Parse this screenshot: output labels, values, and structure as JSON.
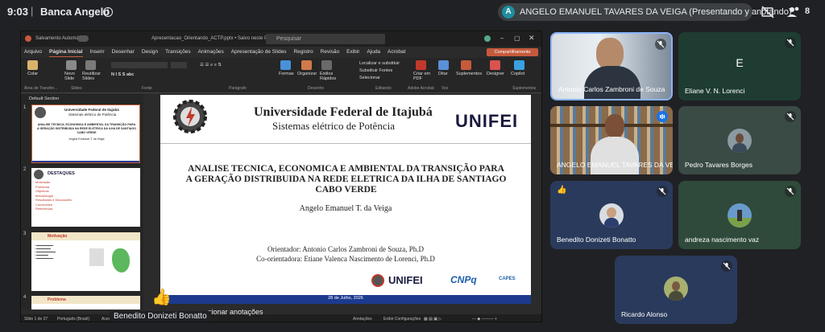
{
  "meet": {
    "time": "9:03",
    "separator": "|",
    "meeting_name": "Banca Angelo",
    "presenter_initial": "A",
    "presenter_text": "ANGELO EMANUEL TAVARES DA VEIGA (Presentando y anotando)",
    "people_count": "8",
    "caption_name": "Benedito Donizeti Bonatto",
    "notes_text": "cionar anotações"
  },
  "ppt": {
    "title_left": "Salvamento Automático",
    "title_file": "Apresentacao_Orientando_ACTP.pptx • Salvo neste PC",
    "search_placeholder": "Pesquisar",
    "menu": [
      "Arquivo",
      "Página Inicial",
      "Inserir",
      "Desenhar",
      "Design",
      "Transições",
      "Animações",
      "Apresentação de Slides",
      "Registro",
      "Revisão",
      "Exibir",
      "Ajuda",
      "Acrobat"
    ],
    "active_menu": "Página Inicial",
    "share_label": "Compartilhamento",
    "ribbon": {
      "colar": "Colar",
      "novo_slide": "Novo Slide",
      "reuse": "Reutilizar Slides",
      "formas": "Formas",
      "organizar": "Organizar",
      "estilos": "Estilos Rápidos",
      "localizar": "Localizar e substituir",
      "substituir": "Substituir Fontes",
      "selecionar": "Selecionar",
      "criar_pdf": "Criar em PDF",
      "ditar": "Ditar",
      "suplementos": "Suplementos",
      "designer": "Designer",
      "copilot": "Copilot",
      "groups": [
        "Área de Transfer...",
        "Slides",
        "Fonte",
        "Parágrafo",
        "Desenho",
        "Editando",
        "Adobe Acrobat",
        "Voz",
        "Suplementos"
      ]
    },
    "section_label": "Default Section",
    "thumb2_title": "DESTAQUES",
    "thumb2_items": [
      "Motivação",
      "Problema",
      "Objetivos",
      "Metodologia",
      "Resultados e Discussões",
      "Conclusões",
      "Referências"
    ],
    "thumb3_title": "Motivação",
    "thumb4_title": "Problema",
    "status_slide": "Slide 1 de 27",
    "status_lang": "Português (Brasil)",
    "status_acc": "Acessibilidade",
    "status_notes": "Anotações",
    "status_view": "Exibir Configurações"
  },
  "slide": {
    "university": "Universidade Federal de Itajubá",
    "subtitle": "Sistemas elétrico de Potência",
    "logo_text": "UNIFEI",
    "title_lines": [
      "ANALISE TECNICA,  ECONOMICA E AMBIENTAL DA TRANSIÇÃO PARA",
      "A GERAÇÃO DISTRIBUIDA NA REDE ELETRICA DA ILHA DE SANTIAGO",
      "CABO VERDE"
    ],
    "author": "Angelo Emanuel T. da Veiga",
    "advisor": "Orientador: Antonio Carlos Zambroni de Souza, Ph.D",
    "coadvisor": "Co-orientadora: Etiane Valenca Nascimento de Lorenci,  Ph.D",
    "footer_logo1": "UNIFEI",
    "footer_logo2": "CNPq",
    "footer_logo3": "CAPES",
    "date": "28 de Julho, 2026"
  },
  "participants": [
    {
      "name": "Antonio Carlos Zambroni de Souza",
      "type": "video"
    },
    {
      "name": "Eliane V. N. Lorenci",
      "initial": "E",
      "type": "letter"
    },
    {
      "name": "ANGELO EMANUEL TAVARES DA VEIGA",
      "type": "video"
    },
    {
      "name": "Pedro Tavares Borges",
      "type": "avatar"
    },
    {
      "name": "Benedito Donizeti Bonatto",
      "type": "avatar"
    },
    {
      "name": "andreza nascimento vaz",
      "type": "avatar"
    },
    {
      "name": "Ricardo Alonso",
      "type": "avatar"
    }
  ],
  "colors": {
    "meet_bg": "#202124",
    "tile_green": "#1e3c32",
    "tile_blue": "#2a3a5c",
    "ppt_accent": "#c55a3d",
    "slide_footer": "#1c3a8e"
  }
}
